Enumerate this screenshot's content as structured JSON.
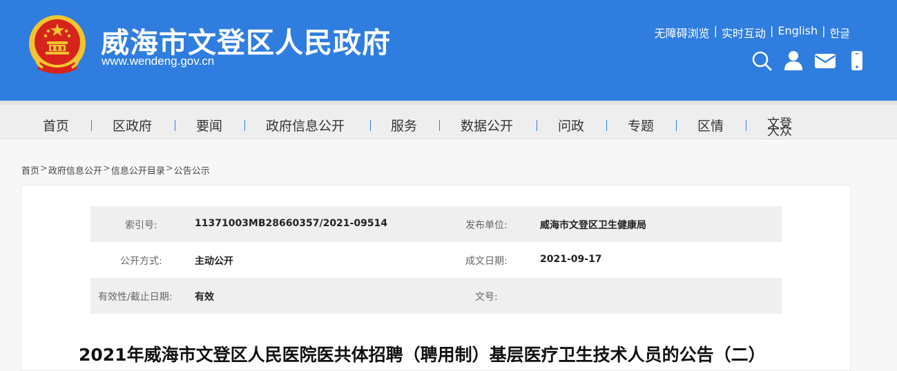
{
  "header": {
    "title": "威海市文登区人民政府",
    "url": "www.wendeng.gov.cn",
    "top_links": [
      "无障碍浏览",
      "实时互动",
      "English",
      "한글"
    ],
    "tools": [
      {
        "icon": "search-icon"
      },
      {
        "icon": "user-icon"
      },
      {
        "icon": "mail-icon"
      },
      {
        "icon": "mobile-icon"
      }
    ]
  },
  "nav": {
    "items": [
      "首页",
      "区政府",
      "要闻",
      "政府信息公开",
      "服务",
      "数据公开",
      "问政",
      "专题",
      "区情",
      "文登大众"
    ]
  },
  "breadcrumb": {
    "items": [
      "首页",
      "政府信息公开",
      "信息公开目录",
      "公告公示"
    ],
    "separator": ">"
  },
  "meta": {
    "index_label": "索引号:",
    "index_value": "11371003MB28660357/2021-09514",
    "publisher_label": "发布单位:",
    "publisher_value": "威海市文登区卫生健康局",
    "disclosure_label": "公开方式:",
    "disclosure_value": "主动公开",
    "date_label": "成文日期:",
    "date_value": "2021-09-17",
    "validity_label": "有效性/截止日期:",
    "validity_value": "有效",
    "docno_label": "文号:",
    "docno_value": ""
  },
  "article": {
    "title": "2021年威海市文登区人民医院医共体招聘（聘用制）基层医疗卫生技术人员的公告（二）"
  },
  "colors": {
    "header_bg": "#2f7ddf",
    "emblem_red": "#d6241c",
    "emblem_gold": "#f2c42f",
    "nav_bg": "#eeeeee",
    "nav_separator": "#2f7ddf"
  }
}
